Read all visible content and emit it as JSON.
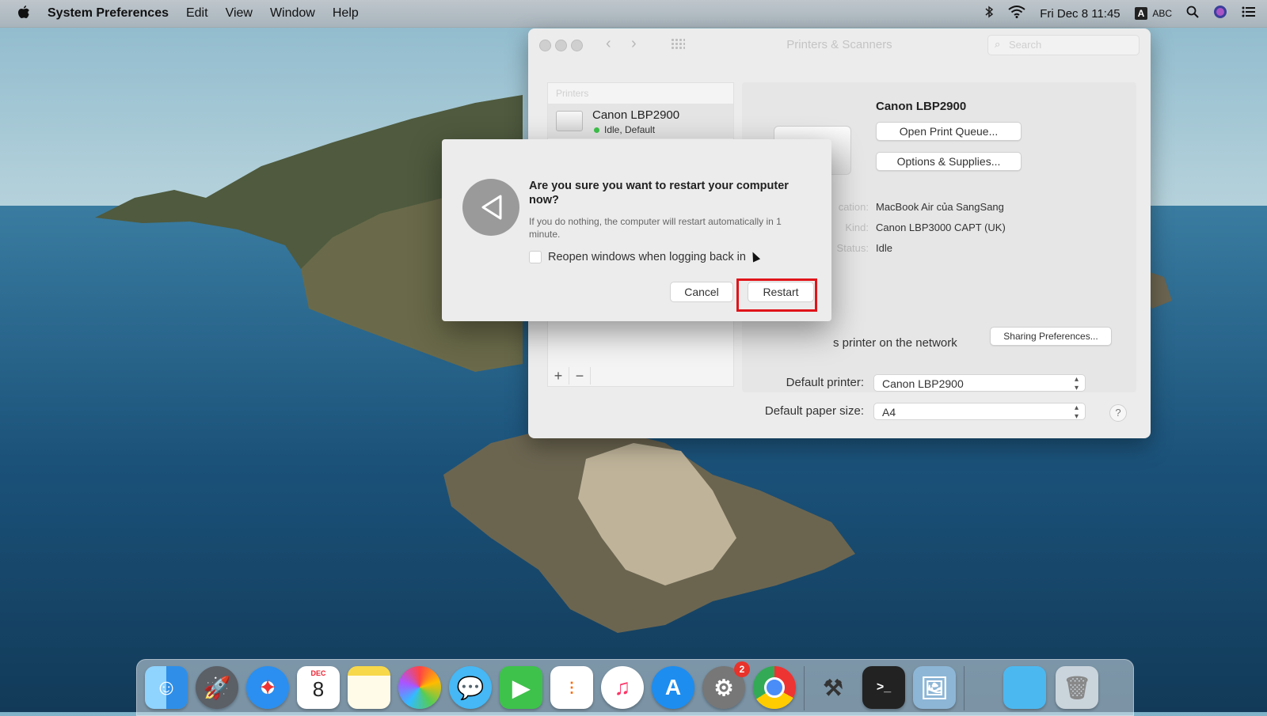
{
  "menubar": {
    "app_name": "System Preferences",
    "menus": [
      "Edit",
      "View",
      "Window",
      "Help"
    ],
    "clock": "Fri Dec 8  11:45",
    "input_badge": "A",
    "input_source": "ABC"
  },
  "window": {
    "title": "Printers & Scanners",
    "search_placeholder": "Search",
    "printers_header": "Printers",
    "printer": {
      "name": "Canon LBP2900",
      "status": "Idle, Default"
    },
    "plus": "+",
    "minus": "−",
    "detail": {
      "title": "Canon LBP2900",
      "open_queue_label": "Open Print Queue...",
      "options_label": "Options & Supplies...",
      "location_label": "cation:",
      "location_value": "MacBook Air của SangSang",
      "kind_label": "Kind:",
      "kind_value": "Canon LBP3000 CAPT (UK)",
      "status_label": "Status:",
      "status_value": "Idle",
      "share_text": "s printer on the network",
      "sharing_prefs_label": "Sharing Preferences..."
    },
    "default_printer_label": "Default printer:",
    "default_printer_value": "Canon LBP2900",
    "default_paper_label": "Default paper size:",
    "default_paper_value": "A4",
    "help": "?"
  },
  "dialog": {
    "title": "Are you sure you want to restart your computer now?",
    "subtitle": "If you do nothing, the computer will restart automatically in 1 minute.",
    "checkbox_label": "Reopen windows when logging back in",
    "cancel_label": "Cancel",
    "restart_label": "Restart"
  },
  "dock": {
    "calendar_month": "DEC",
    "calendar_day": "8",
    "sysprefs_badge": "2",
    "icons": [
      "finder-icon",
      "launchpad-icon",
      "safari-icon",
      "calendar-icon",
      "notes-icon",
      "photos-icon",
      "messages-icon",
      "facetime-icon",
      "reminders-icon",
      "music-icon",
      "app-store-icon",
      "system-preferences-icon",
      "chrome-icon",
      "xcode-instruments-icon",
      "terminal-icon",
      "preview-icon",
      "folder-icon",
      "trash-icon"
    ]
  },
  "colors": {
    "highlight": "#e0141a",
    "status_green": "#3ec24b",
    "badge_red": "#e8322a"
  }
}
